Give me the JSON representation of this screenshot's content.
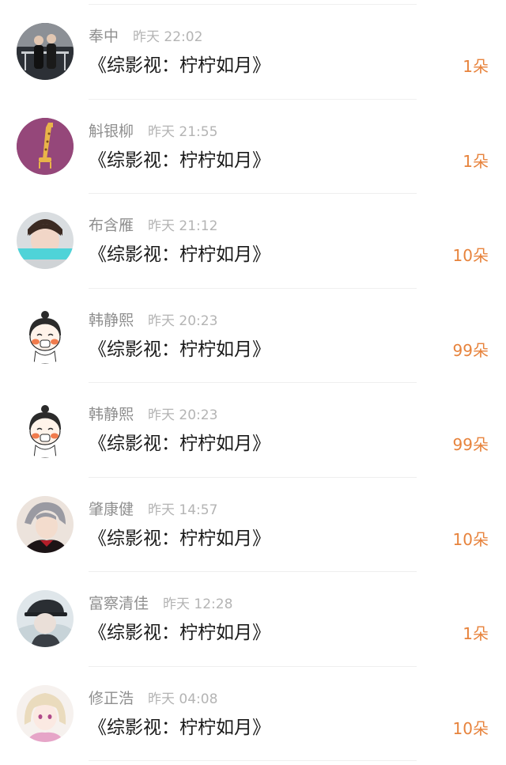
{
  "records": [
    {
      "name": "奉中",
      "time": "昨天 22:02",
      "title": "《综影视：柠柠如月》",
      "gift": "1朵",
      "avatar_icon": "couple-photo-avatar"
    },
    {
      "name": "斛银柳",
      "time": "昨天 21:55",
      "title": "《综影视：柠柠如月》",
      "gift": "1朵",
      "avatar_icon": "giraffe-avatar"
    },
    {
      "name": "布含雁",
      "time": "昨天 21:12",
      "title": "《综影视：柠柠如月》",
      "gift": "10朵",
      "avatar_icon": "boy-photo-avatar"
    },
    {
      "name": "韩静熙",
      "time": "昨天 20:23",
      "title": "《综影视：柠柠如月》",
      "gift": "99朵",
      "avatar_icon": "cartoon-girl-avatar"
    },
    {
      "name": "韩静熙",
      "time": "昨天 20:23",
      "title": "《综影视：柠柠如月》",
      "gift": "99朵",
      "avatar_icon": "cartoon-girl-avatar"
    },
    {
      "name": "肇康健",
      "time": "昨天 14:57",
      "title": "《综影视：柠柠如月》",
      "gift": "10朵",
      "avatar_icon": "anime-boy-avatar"
    },
    {
      "name": "富察清佳",
      "time": "昨天 12:28",
      "title": "《综影视：柠柠如月》",
      "gift": "1朵",
      "avatar_icon": "anime-cap-avatar"
    },
    {
      "name": "修正浩",
      "time": "昨天 04:08",
      "title": "《综影视：柠柠如月》",
      "gift": "10朵",
      "avatar_icon": "anime-blonde-avatar"
    }
  ],
  "colors": {
    "gift": "#e7833c",
    "name": "#8f8f8f",
    "time": "#b4b4b4",
    "title": "#1a1a1a",
    "divider": "#efefef"
  }
}
